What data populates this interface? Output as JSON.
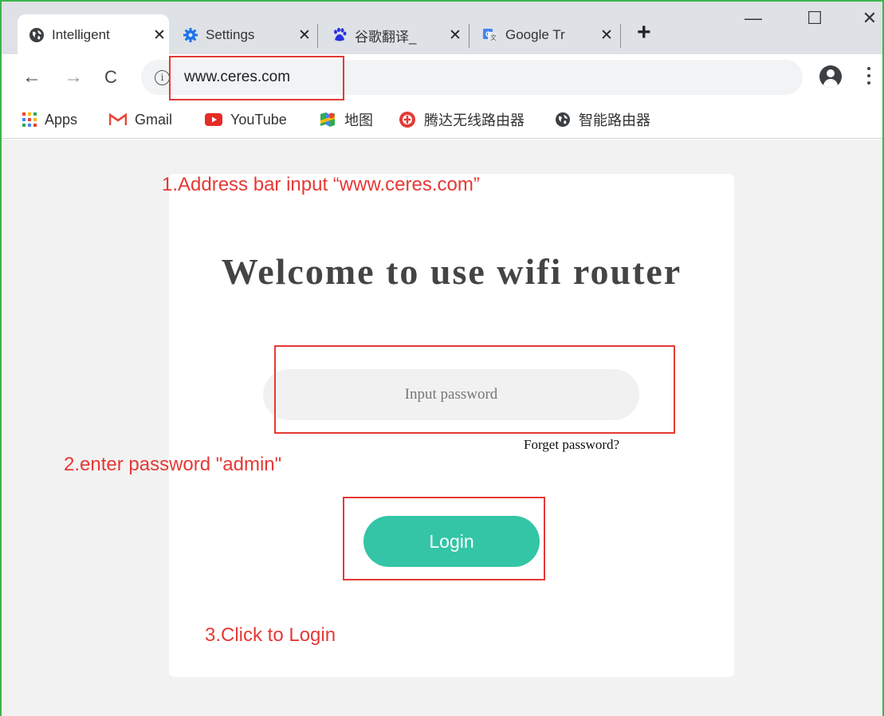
{
  "tabs": [
    {
      "title": "Intelligent",
      "favicon": "globe-icon",
      "active": true
    },
    {
      "title": "Settings",
      "favicon": "settings-gear-icon",
      "active": false
    },
    {
      "title": "谷歌翻译_",
      "favicon": "baidu-paw-icon",
      "active": false
    },
    {
      "title": "Google Tr",
      "favicon": "google-translate-icon",
      "active": false
    }
  ],
  "tab_close_glyph": "✕",
  "new_tab_glyph": "+",
  "window_controls": {
    "minimize": "—",
    "maximize": "☐",
    "close": "✕"
  },
  "toolbar": {
    "back": "←",
    "forward": "→",
    "reload": "C",
    "info": "i"
  },
  "address_bar": {
    "url": "www.ceres.com"
  },
  "bookmarks": [
    {
      "label": "Apps",
      "icon": "apps-grid-icon"
    },
    {
      "label": "Gmail",
      "icon": "gmail-icon"
    },
    {
      "label": "YouTube",
      "icon": "youtube-icon"
    },
    {
      "label": "地图",
      "icon": "maps-icon"
    },
    {
      "label": "腾达无线路由器",
      "icon": "tenda-icon"
    },
    {
      "label": "智能路由器",
      "icon": "globe-icon"
    }
  ],
  "login": {
    "heading": "Welcome to use wifi router",
    "password_placeholder": "Input password",
    "forget_link": "Forget password?",
    "login_button": "Login"
  },
  "annotations": {
    "step1": "1.Address bar input  “www.ceres.com”",
    "step2": "2.enter password \"admin\"",
    "step3": "3.Click to Login"
  },
  "colors": {
    "annotation": "#e53935",
    "login_button": "#33c5a5",
    "frame": "#3cb44b"
  }
}
